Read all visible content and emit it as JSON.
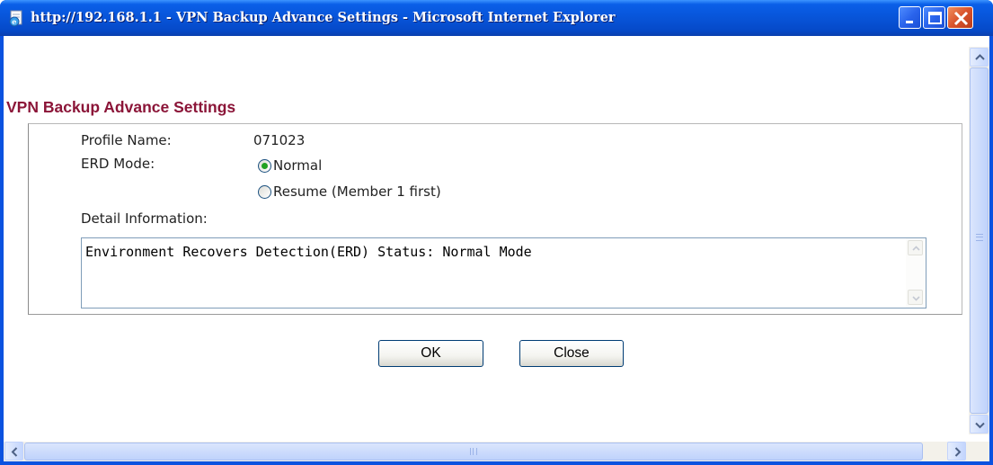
{
  "window": {
    "title": "http://192.168.1.1 - VPN Backup Advance Settings - Microsoft Internet Explorer"
  },
  "page": {
    "title": "VPN Backup Advance Settings"
  },
  "form": {
    "profile_name_label": "Profile Name:",
    "profile_name_value": "071023",
    "erd_mode_label": "ERD Mode:",
    "erd_options": [
      {
        "label": "Normal",
        "selected": true
      },
      {
        "label": "Resume (Member 1 first)",
        "selected": false
      }
    ],
    "detail_label": "Detail Information:",
    "detail_text": "Environment Recovers Detection(ERD) Status: Normal Mode"
  },
  "buttons": {
    "ok_label": "OK",
    "close_label": "Close"
  },
  "colors": {
    "title_bar": "#0854d8",
    "page_title": "#8b1538",
    "radio_selected": "#21a121"
  }
}
